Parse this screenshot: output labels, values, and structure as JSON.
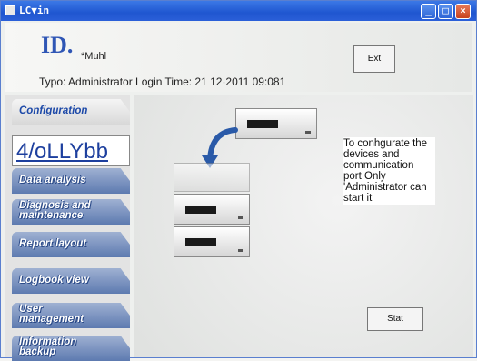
{
  "window": {
    "title": "LC▼in"
  },
  "header": {
    "logo": "ID.",
    "logo_sub": "*Muhl",
    "login_info": "Typo: Administrator Login Time: 21 12·2011 09:081",
    "exit_label": "Ext"
  },
  "sidebar": {
    "items": [
      {
        "label": "Configuration"
      },
      {
        "label": "4/oLLYbb"
      },
      {
        "label": "Data analysis"
      },
      {
        "label": "Diagnosis and\nmaintenance"
      },
      {
        "label": "Report layout"
      },
      {
        "label": "Logbook view"
      },
      {
        "label": "User\nmanagement"
      },
      {
        "label": "Information\nbackup"
      }
    ]
  },
  "main": {
    "description": "To conhgurate the devices and communication port Only 'Administrator can start it",
    "start_label": "Stat"
  },
  "colors": {
    "titlebar": "#2b5fd8",
    "accent": "#1d49a8"
  }
}
